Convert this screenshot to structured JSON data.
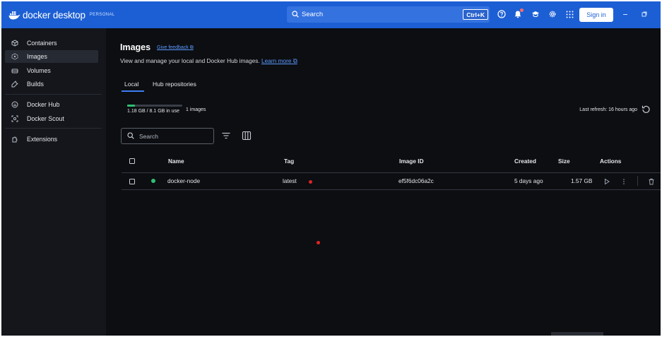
{
  "header": {
    "logo_text": "docker desktop",
    "logo_badge": "PERSONAL",
    "search_label": "Search",
    "search_shortcut": "Ctrl+K",
    "sign_in": "Sign in",
    "brand_color": "#1c5fd4"
  },
  "sidebar": {
    "items": [
      {
        "label": "Containers",
        "icon": "containers-icon"
      },
      {
        "label": "Images",
        "icon": "images-icon",
        "active": true
      },
      {
        "label": "Volumes",
        "icon": "volumes-icon"
      },
      {
        "label": "Builds",
        "icon": "builds-icon"
      },
      {
        "label": "Docker Hub",
        "icon": "docker-hub-icon"
      },
      {
        "label": "Docker Scout",
        "icon": "docker-scout-icon"
      },
      {
        "label": "Extensions",
        "icon": "extensions-icon"
      }
    ]
  },
  "main": {
    "title": "Images",
    "feedback": "Give feedback",
    "subtitle": "View and manage your local and Docker Hub images.",
    "learn_more": "Learn more",
    "tabs": [
      {
        "label": "Local",
        "active": true
      },
      {
        "label": "Hub repositories"
      }
    ],
    "usage": {
      "text": "1.18 GB / 8.1 GB in use",
      "fraction": 0.146
    },
    "image_count": "1 images",
    "last_refresh": "Last refresh: 16 hours ago",
    "search_placeholder": "Search",
    "table": {
      "headers": [
        "Name",
        "Tag",
        "Image ID",
        "Created",
        "Size",
        "Actions"
      ],
      "rows": [
        {
          "name": "docker-node",
          "tag": "latest",
          "image_id": "ef5f6dc06a2c",
          "created": "5 days ago",
          "size": "1.57 GB",
          "status_color": "#2fbf71"
        }
      ]
    }
  }
}
